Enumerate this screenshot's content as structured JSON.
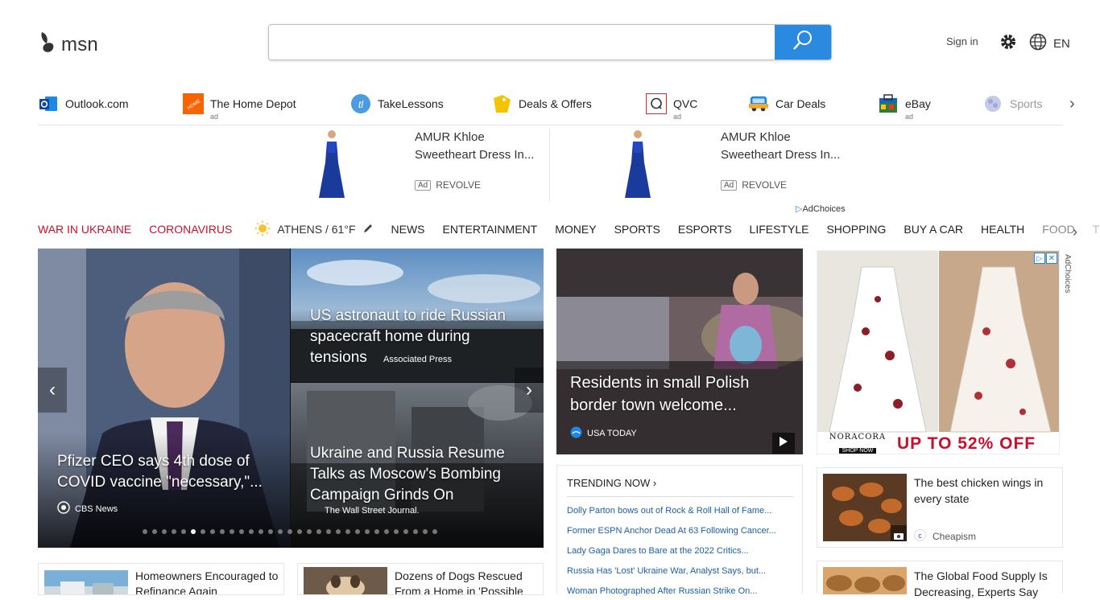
{
  "header": {
    "logo_text": "msn",
    "search_placeholder": "",
    "signin": "Sign in",
    "language": "EN"
  },
  "quicklinks": [
    {
      "label": "Outlook.com",
      "icon": "outlook-icon",
      "ad": ""
    },
    {
      "label": "The Home Depot",
      "icon": "home-depot-icon",
      "ad": "ad"
    },
    {
      "label": "TakeLessons",
      "icon": "takelessons-icon",
      "ad": ""
    },
    {
      "label": "Deals & Offers",
      "icon": "deals-icon",
      "ad": ""
    },
    {
      "label": "QVC",
      "icon": "qvc-icon",
      "ad": "ad"
    },
    {
      "label": "Car Deals",
      "icon": "car-icon",
      "ad": ""
    },
    {
      "label": "eBay",
      "icon": "ebay-icon",
      "ad": "ad"
    },
    {
      "label": "Sports",
      "icon": "sports-icon",
      "ad": ""
    }
  ],
  "ads": [
    {
      "title_line1": "AMUR Khloe",
      "title_line2": "Sweetheart Dress In...",
      "badge": "Ad",
      "source": "REVOLVE"
    },
    {
      "title_line1": "AMUR Khloe",
      "title_line2": "Sweetheart Dress In...",
      "badge": "Ad",
      "source": "REVOLVE"
    }
  ],
  "adchoices": "AdChoices",
  "nav": {
    "red": [
      "WAR IN UKRAINE",
      "CORONAVIRUS"
    ],
    "weather": "ATHENS / 61°F",
    "items": [
      "NEWS",
      "ENTERTAINMENT",
      "MONEY",
      "SPORTS",
      "ESPORTS",
      "LIFESTYLE",
      "SHOPPING",
      "BUY A CAR",
      "HEALTH"
    ],
    "faded1": "FOOD",
    "faded2": "TRAVEL"
  },
  "hero": {
    "main_title": "Pfizer CEO says 4th dose of COVID vaccine \"necessary,\"...",
    "main_source": "CBS News",
    "top_right_title": "US astronaut to ride Russian spacecraft home during tensions",
    "top_right_source": "Associated Press",
    "bottom_right_title": "Ukraine and Russia Resume Talks as Moscow's Bombing Campaign Grinds On",
    "bottom_right_source": "The Wall Street Journal.",
    "dot_count": 31,
    "active_dot": 5
  },
  "feature": {
    "title": "Residents in small Polish border town welcome...",
    "source": "USA TODAY"
  },
  "trending": {
    "header": "TRENDING NOW",
    "links": [
      "Dolly Parton bows out of Rock & Roll Hall of Fame...",
      "Former ESPN Anchor Dead At 63 Following Cancer...",
      "Lady Gaga Dares to Bare at the 2022 Critics...",
      "Russia Has 'Lost' Ukraine War, Analyst Says, but...",
      "Woman Photographed After Russian Strike On..."
    ]
  },
  "right_ad": {
    "brand": "NORACORA",
    "cta": "SHOP NOW",
    "promo": "UP TO 52% OFF",
    "adchoices": "AdChoices"
  },
  "right_cards": [
    {
      "title": "The best chicken wings in every state",
      "source": "Cheapism"
    },
    {
      "title": "The Global Food Supply Is Decreasing, Experts Say",
      "source": ""
    }
  ],
  "bottom_cards": [
    {
      "title": "Homeowners Encouraged to Refinance Again"
    },
    {
      "title": "Dozens of Dogs Rescued From a Home in 'Possible"
    }
  ]
}
